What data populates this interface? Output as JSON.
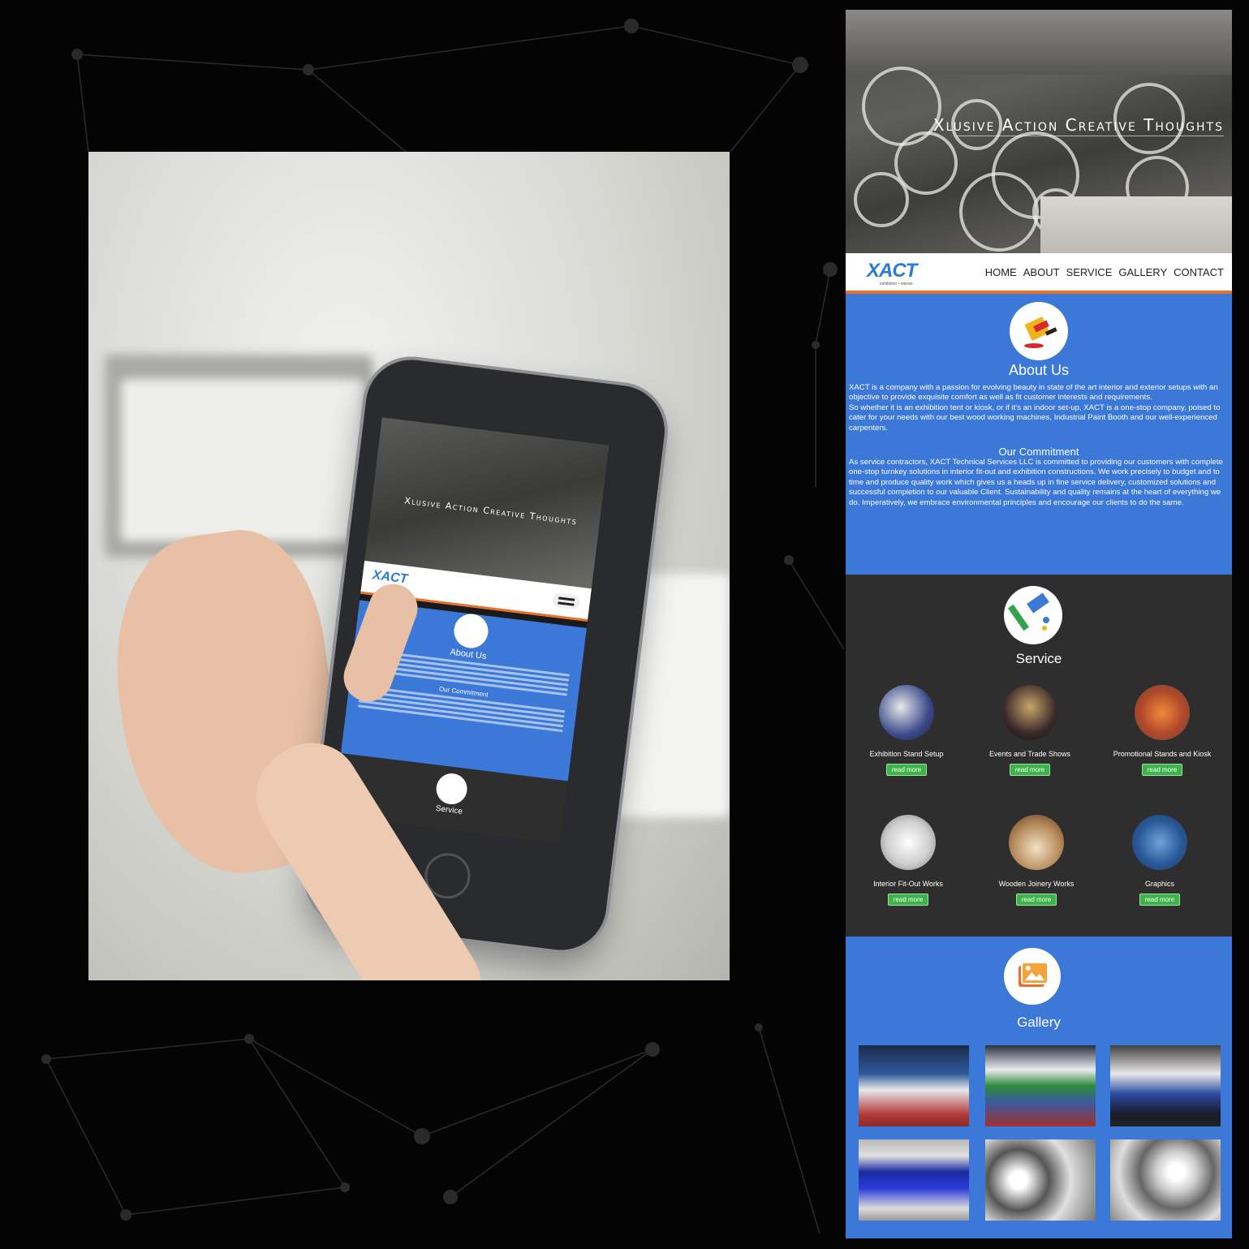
{
  "hero": {
    "tagline": "Xlusive Action Creative Thoughts"
  },
  "brand": {
    "logo": "XACT",
    "logo_sub": "exhibition • interior"
  },
  "nav": [
    "HOME",
    "ABOUT",
    "SERVICE",
    "GALLERY",
    "CONTACT"
  ],
  "about": {
    "title": "About Us",
    "paragraph1": "XACT is a company with a passion for evolving beauty in state of the art interior and exterior setups with an objective to provide exquisite comfort as well as fit customer interests and requirements.",
    "paragraph2": "So whether it is an exhibition tent or kiosk, or if it's an indoor set-up, XACT is a one-stop company, poised to cater for your needs with our best wood working machines, Industrial Paint Booth and our well-experienced carpenters.",
    "commitment_title": "Our Commitment",
    "commitment_text": "As service contractors, XACT Technical Services LLC is committed to providing our customers with complete one-stop turnkey solutions in interior fit-out and exhibition constructions. We work precisely to budget and to time and produce quality work which gives us a heads up in fine service delivery, customized solutions and successful completion to our valuable Client. Sustainability and quality remains at the heart of everything we do. Imperatively, we embrace environmental principles and encourage our clients to do the same."
  },
  "service": {
    "title": "Service",
    "items": [
      {
        "name": "Exhibition Stand Setup",
        "button": "read more"
      },
      {
        "name": "Events and Trade Shows",
        "button": "read more"
      },
      {
        "name": "Promotional Stands and Kiosk",
        "button": "read more"
      },
      {
        "name": "Interior Fit-Out Works",
        "button": "read more"
      },
      {
        "name": "Wooden Joinery Works",
        "button": "read more"
      },
      {
        "name": "Graphics",
        "button": "read more"
      }
    ]
  },
  "gallery": {
    "title": "Gallery"
  },
  "mobile": {
    "about_title": "About Us",
    "commitment_title": "Our Commitment",
    "service_title": "Service"
  },
  "colors": {
    "blue": "#3b78d8",
    "dark": "#2e2e2e",
    "orange": "#e8702a",
    "green": "#3db34a",
    "background": "#040404"
  }
}
